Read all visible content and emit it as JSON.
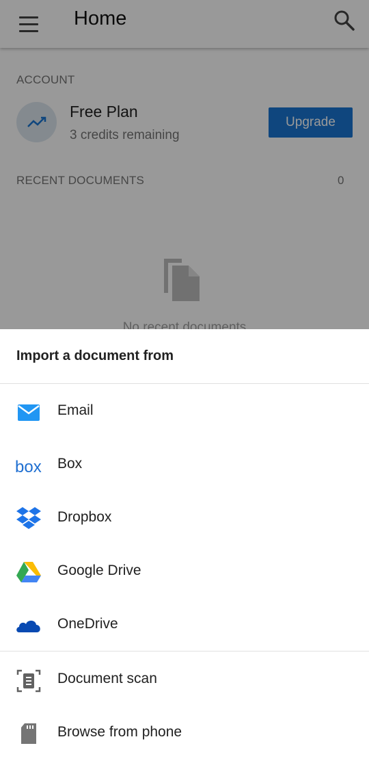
{
  "app_bar": {
    "title": "Home",
    "menu_icon": "menu-icon",
    "search_icon": "search-icon"
  },
  "account": {
    "section_label": "ACCOUNT",
    "plan_name": "Free Plan",
    "credits": "3 credits remaining",
    "upgrade_label": "Upgrade",
    "avatar_icon": "trending-up-icon"
  },
  "recent": {
    "section_label": "RECENT DOCUMENTS",
    "count": "0",
    "empty_text": "No recent documents",
    "empty_icon": "documents-icon"
  },
  "import_sheet": {
    "title": "Import a document from",
    "sources": [
      {
        "label": "Email",
        "icon": "email-icon"
      },
      {
        "label": "Box",
        "icon": "box-logo-icon"
      },
      {
        "label": "Dropbox",
        "icon": "dropbox-logo-icon"
      },
      {
        "label": "Google Drive",
        "icon": "google-drive-logo-icon"
      },
      {
        "label": "OneDrive",
        "icon": "onedrive-logo-icon"
      }
    ],
    "local": [
      {
        "label": "Document scan",
        "icon": "document-scan-icon"
      },
      {
        "label": "Browse from phone",
        "icon": "sd-card-icon"
      }
    ]
  },
  "colors": {
    "accent": "#1976d2",
    "scrim": "rgba(0,0,0,0.40)"
  }
}
